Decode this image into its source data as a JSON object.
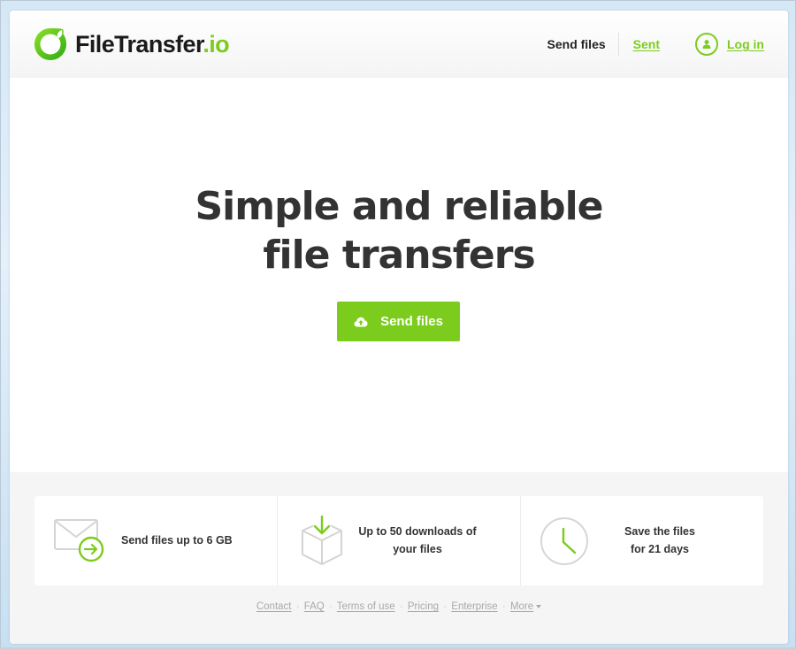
{
  "brand": {
    "name": "FileTransfer",
    "tld": ".io",
    "accent_color": "#7ccc1e",
    "logo_icon": "leaf-ring-icon"
  },
  "nav": {
    "send_files": "Send files",
    "sent": "Sent",
    "login": "Log in",
    "login_icon": "user-icon"
  },
  "hero": {
    "title_line1": "Simple and reliable",
    "title_line2": "file transfers",
    "cta_label": "Send files",
    "cta_icon": "cloud-upload-icon"
  },
  "features": [
    {
      "icon": "envelope-arrow-icon",
      "line1": "Send files up to 6 GB",
      "line2": ""
    },
    {
      "icon": "box-download-icon",
      "line1": "Up to 50 downloads of",
      "line2": "your files"
    },
    {
      "icon": "clock-icon",
      "line1": "Save the files",
      "line2": "for 21 days"
    }
  ],
  "footer": {
    "links": [
      "Contact",
      "FAQ",
      "Terms of use",
      "Pricing",
      "Enterprise",
      "More"
    ],
    "separator": "·"
  }
}
